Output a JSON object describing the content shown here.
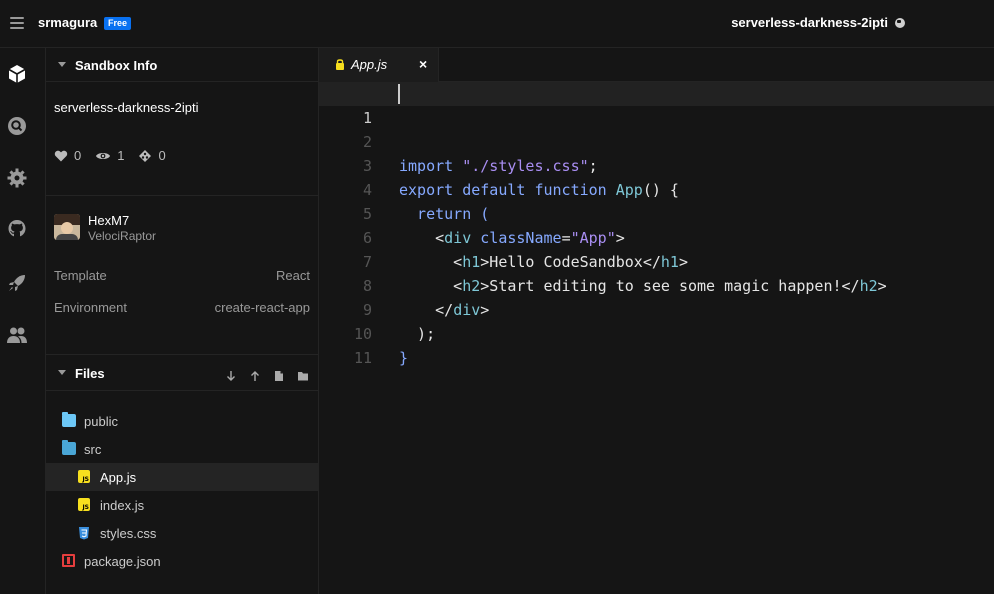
{
  "topbar": {
    "username": "srmagura",
    "badge": "Free",
    "sandbox_title": "serverless-darkness-2ipti"
  },
  "activity_icons": [
    "cube-icon",
    "search-icon",
    "gear-icon",
    "github-icon",
    "rocket-icon",
    "users-icon"
  ],
  "sidebar": {
    "info_header": "Sandbox Info",
    "sandbox_name": "serverless-darkness-2ipti",
    "stats": {
      "likes": "0",
      "views": "1",
      "forks": "0"
    },
    "author": {
      "name": "HexM7",
      "subtitle": "VelociRaptor"
    },
    "template_label": "Template",
    "template_value": "React",
    "environment_label": "Environment",
    "environment_value": "create-react-app",
    "files_header": "Files",
    "files": [
      {
        "name": "public",
        "type": "folder"
      },
      {
        "name": "src",
        "type": "folder-open"
      },
      {
        "name": "App.js",
        "type": "js",
        "active": true
      },
      {
        "name": "index.js",
        "type": "js"
      },
      {
        "name": "styles.css",
        "type": "css"
      },
      {
        "name": "package.json",
        "type": "package"
      }
    ]
  },
  "editor": {
    "tab_label": "App.js",
    "tab_close": "×",
    "line_numbers": [
      "1",
      "2",
      "3",
      "4",
      "5",
      "6",
      "7",
      "8",
      "9",
      "10",
      "11"
    ],
    "code": {
      "l1_kw": "import",
      "l1_str": "\"./styles.css\"",
      "l1_end": ";",
      "l3_kw": "export default function",
      "l3_fn": "App",
      "l3_end": "() {",
      "l4": "  return (",
      "l5_open": "    <",
      "l5_tag": "div",
      "l5_attr": "className",
      "l5_eq": "=",
      "l5_str": "\"App\"",
      "l5_close": ">",
      "l6_open": "      <",
      "l6_tag": "h1",
      "l6_text": ">Hello CodeSandbox</",
      "l6_tag2": "h1",
      "l6_close": ">",
      "l7_open": "      <",
      "l7_tag": "h2",
      "l7_text": ">Start editing to see some magic happen!</",
      "l7_tag2": "h2",
      "l7_close": ">",
      "l8_open": "    </",
      "l8_tag": "div",
      "l8_close": ">",
      "l9": "  );",
      "l10": "}"
    }
  }
}
